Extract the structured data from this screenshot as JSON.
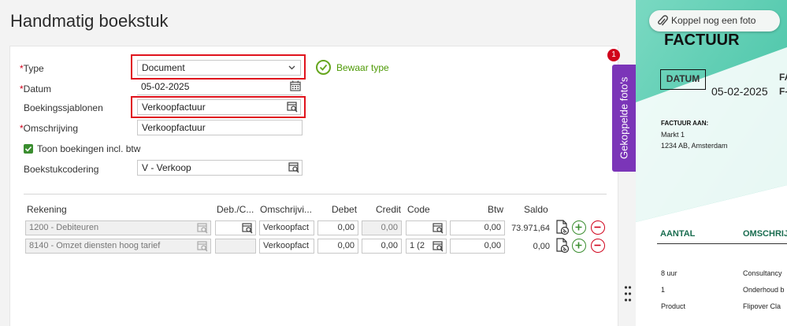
{
  "page": {
    "title": "Handmatig boekstuk"
  },
  "form": {
    "type_label": "Type",
    "type_value": "Document",
    "save_type_label": "Bewaar type",
    "datum_label": "Datum",
    "datum_value": "05-02-2025",
    "sjablonen_label": "Boekingssjablonen",
    "sjablonen_value": "Verkoopfactuur",
    "omschrijving_label": "Omschrijving",
    "omschrijving_value": "Verkoopfactuur",
    "toon_label": "Toon boekingen incl. btw",
    "toon_checked": true,
    "codering_label": "Boekstukcodering",
    "codering_value": "V - Verkoop",
    "required_mark": "*"
  },
  "table": {
    "headers": {
      "rekening": "Rekening",
      "debcred": "Deb./C...",
      "omschrijving": "Omschrijvi...",
      "debet": "Debet",
      "credit": "Credit",
      "code": "Code",
      "btw": "Btw",
      "saldo": "Saldo"
    },
    "rows": [
      {
        "rekening": "1200 - Debiteuren",
        "debcred": "",
        "omschrijving": "Verkoopfact",
        "debet": "0,00",
        "credit": "0,00",
        "code": "",
        "btw": "0,00",
        "saldo": "73.971,64"
      },
      {
        "rekening": "8140 - Omzet diensten hoog tarief",
        "debcred": "",
        "omschrijving": "Verkoopfact",
        "debet": "0,00",
        "credit": "0,00",
        "code": "1 (2",
        "btw": "0,00",
        "saldo": "0,00"
      }
    ]
  },
  "photos_tab": {
    "label": "Gekoppelde foto's",
    "badge": "1"
  },
  "preview": {
    "koppel_label": "Koppel nog een foto",
    "title": "FACTUUR",
    "datum_box": "DATUM",
    "date": "05-02-2025",
    "fa": "FA",
    "f_dash": "F-",
    "factuur_aan": "FACTUUR AAN:",
    "address1": "Markt 1",
    "address2": "1234 AB, Amsterdam",
    "col_aantal": "AANTAL",
    "col_omschrij": "OMSCHRIJ",
    "lines": [
      {
        "aantal": "8 uur",
        "omschr": "Consultancy"
      },
      {
        "aantal": "1",
        "omschr": "Onderhoud b"
      },
      {
        "aantal": "Product",
        "omschr": "Flipover Cla"
      }
    ]
  },
  "colors": {
    "accent_green": "#3a8d2f",
    "highlight_red": "#e0131d",
    "tab_purple": "#7b35b8",
    "preview_teal": "#3cc3a5"
  }
}
